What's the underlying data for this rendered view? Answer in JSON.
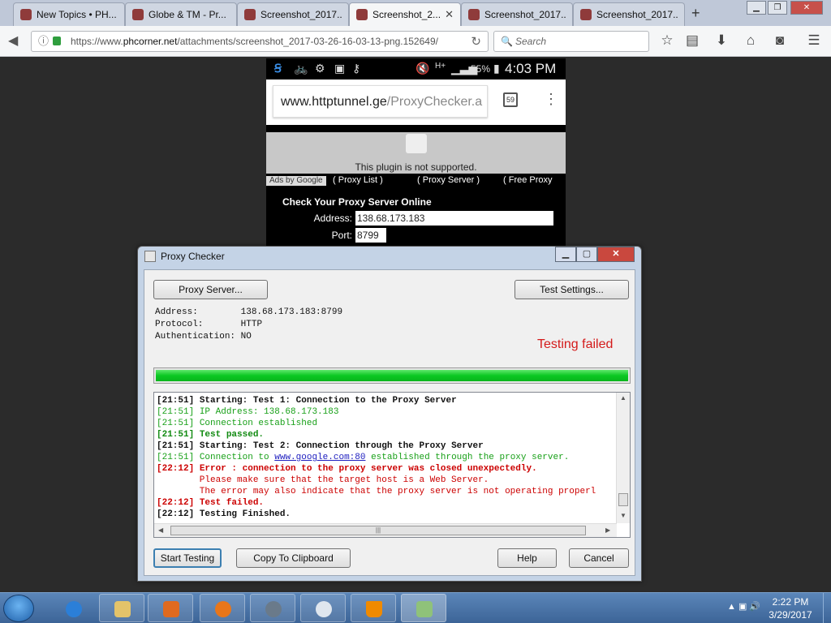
{
  "browser": {
    "tabs": [
      {
        "label": "New Topics • PH..."
      },
      {
        "label": "Globe & TM - Pr..."
      },
      {
        "label": "Screenshot_2017..."
      },
      {
        "label": "Screenshot_2...",
        "active": true
      },
      {
        "label": "Screenshot_2017..."
      },
      {
        "label": "Screenshot_2017..."
      }
    ],
    "url_prefix": "https://www.",
    "url_domain": "phcorner.net",
    "url_path": "/attachments/screenshot_2017-03-26-16-03-13-png.152649/",
    "search_placeholder": "Search"
  },
  "phone": {
    "battery": "55%",
    "time": "4:03 PM",
    "url_host": "www.httptunnel.ge",
    "url_path": "/ProxyChecker.a",
    "tab_count": "59",
    "plugin_message": "This plugin is not supported.",
    "ads_label": "Ads by Google",
    "links": [
      "Proxy List",
      "Proxy Server",
      "Free Proxy"
    ],
    "title": "Check Your Proxy Server Online",
    "address_label": "Address:",
    "address_value": "138.68.173.183",
    "port_label": "Port:",
    "port_value": "8799"
  },
  "dialog": {
    "title": "Proxy Checker",
    "proxy_server_button": "Proxy Server...",
    "test_settings_button": "Test Settings...",
    "address_label": "Address:",
    "address_value": "138.68.173.183:8799",
    "protocol_label": "Protocol:",
    "protocol_value": "HTTP",
    "auth_label": "Authentication:",
    "auth_value": "NO",
    "status": "Testing failed",
    "progress": 1.0,
    "log": [
      {
        "time": "[21:51]",
        "text": " Starting: Test 1: Connection to the Proxy Server",
        "style": "black"
      },
      {
        "time": "[21:51]",
        "text": " IP Address: 138.68.173.183",
        "style": "green"
      },
      {
        "time": "[21:51]",
        "text": " Connection established",
        "style": "green"
      },
      {
        "time": "[21:51]",
        "text": " Test passed.",
        "style": "greenb"
      },
      {
        "time": "[21:51]",
        "text": " Starting: Test 2: Connection through the Proxy Server",
        "style": "black"
      },
      {
        "time": "[21:51]",
        "text": " Connection to ",
        "link": "www.google.com:80",
        "after": " established through the proxy server.",
        "style": "green"
      },
      {
        "time": "[22:12]",
        "text": " Error : connection to the proxy server was closed unexpectedly.",
        "style": "redb"
      },
      {
        "time": "",
        "text": "        Please make sure that the target host is a Web Server.",
        "style": "red"
      },
      {
        "time": "",
        "text": "        The error may also indicate that the proxy server is not operating properl",
        "style": "red"
      },
      {
        "time": "[22:12]",
        "text": " Test failed.",
        "style": "redb"
      },
      {
        "time": "[22:12]",
        "text": " Testing Finished.",
        "style": "black"
      }
    ],
    "start_button": "Start Testing",
    "copy_button": "Copy To Clipboard",
    "help_button": "Help",
    "cancel_button": "Cancel"
  },
  "taskbar": {
    "time": "2:22 PM",
    "date": "3/29/2017"
  }
}
